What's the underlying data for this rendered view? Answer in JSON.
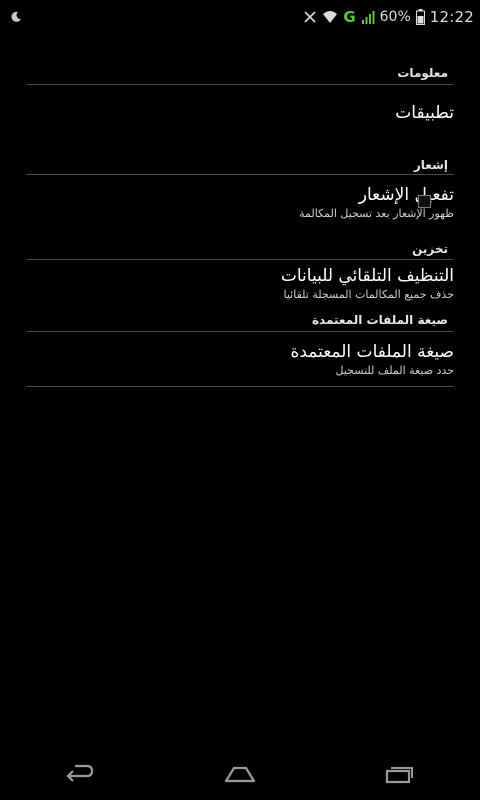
{
  "status_bar": {
    "left_icon": "moon-icon",
    "battery": "60%",
    "network": "G",
    "time": "12:22"
  },
  "sections": {
    "info": {
      "header": "معلومات",
      "item_title": "تطبيقات"
    },
    "notification": {
      "header": "إشعار",
      "title": "تفعيل الإشعار",
      "summary": "ظهور الإشعار بعد تسجيل المكالمة",
      "checked": false
    },
    "storage": {
      "header": "تخزين",
      "title": "التنظيف التلقائي للبيانات",
      "summary": "حذف جميع المكالمات المسجلة تلقائيا"
    },
    "file_format": {
      "header": "صيغة الملفات المعتمدة",
      "title": "صيغة الملفات المعتمدة",
      "summary": "حدد صيغة الملف للتسجيل"
    }
  },
  "nav_bar": {
    "icons": [
      "back-icon",
      "home-icon",
      "recent-apps-icon"
    ]
  },
  "colors": {
    "background": "#000000",
    "divider": "#4a4a4a",
    "signal_green": "#5ac43c"
  }
}
